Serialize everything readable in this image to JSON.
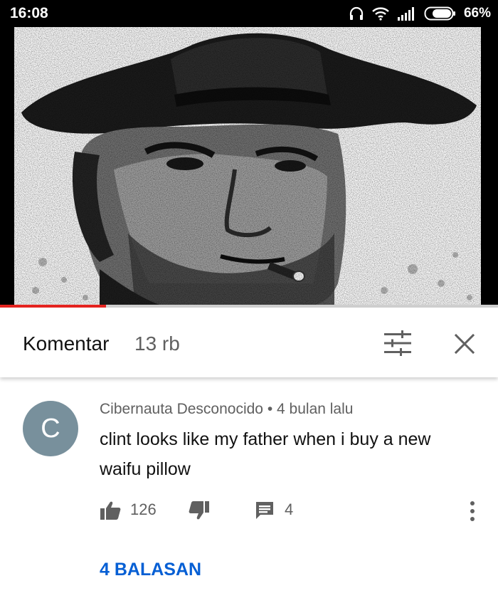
{
  "status_bar": {
    "time": "16:08",
    "battery_percent": "66%",
    "icons": [
      "headphones-icon",
      "wifi-icon",
      "signal-icon",
      "battery-icon"
    ]
  },
  "video": {
    "progress_fraction": 0.213,
    "colors": {
      "progress": "#e5231f",
      "track": "#cfcfcf"
    }
  },
  "comments_header": {
    "title": "Komentar",
    "count": "13 rb",
    "icons": [
      "filter-sort-icon",
      "close-icon"
    ]
  },
  "comment": {
    "avatar_letter": "C",
    "avatar_color": "#78909c",
    "author": "Cibernauta Desconocido",
    "separator": "•",
    "time": "4 bulan lalu",
    "text": "clint looks like my father when i buy a new waifu pillow",
    "likes": "126",
    "replies_count": "4",
    "replies_link": "4 BALASAN",
    "link_color": "#065fd4"
  }
}
